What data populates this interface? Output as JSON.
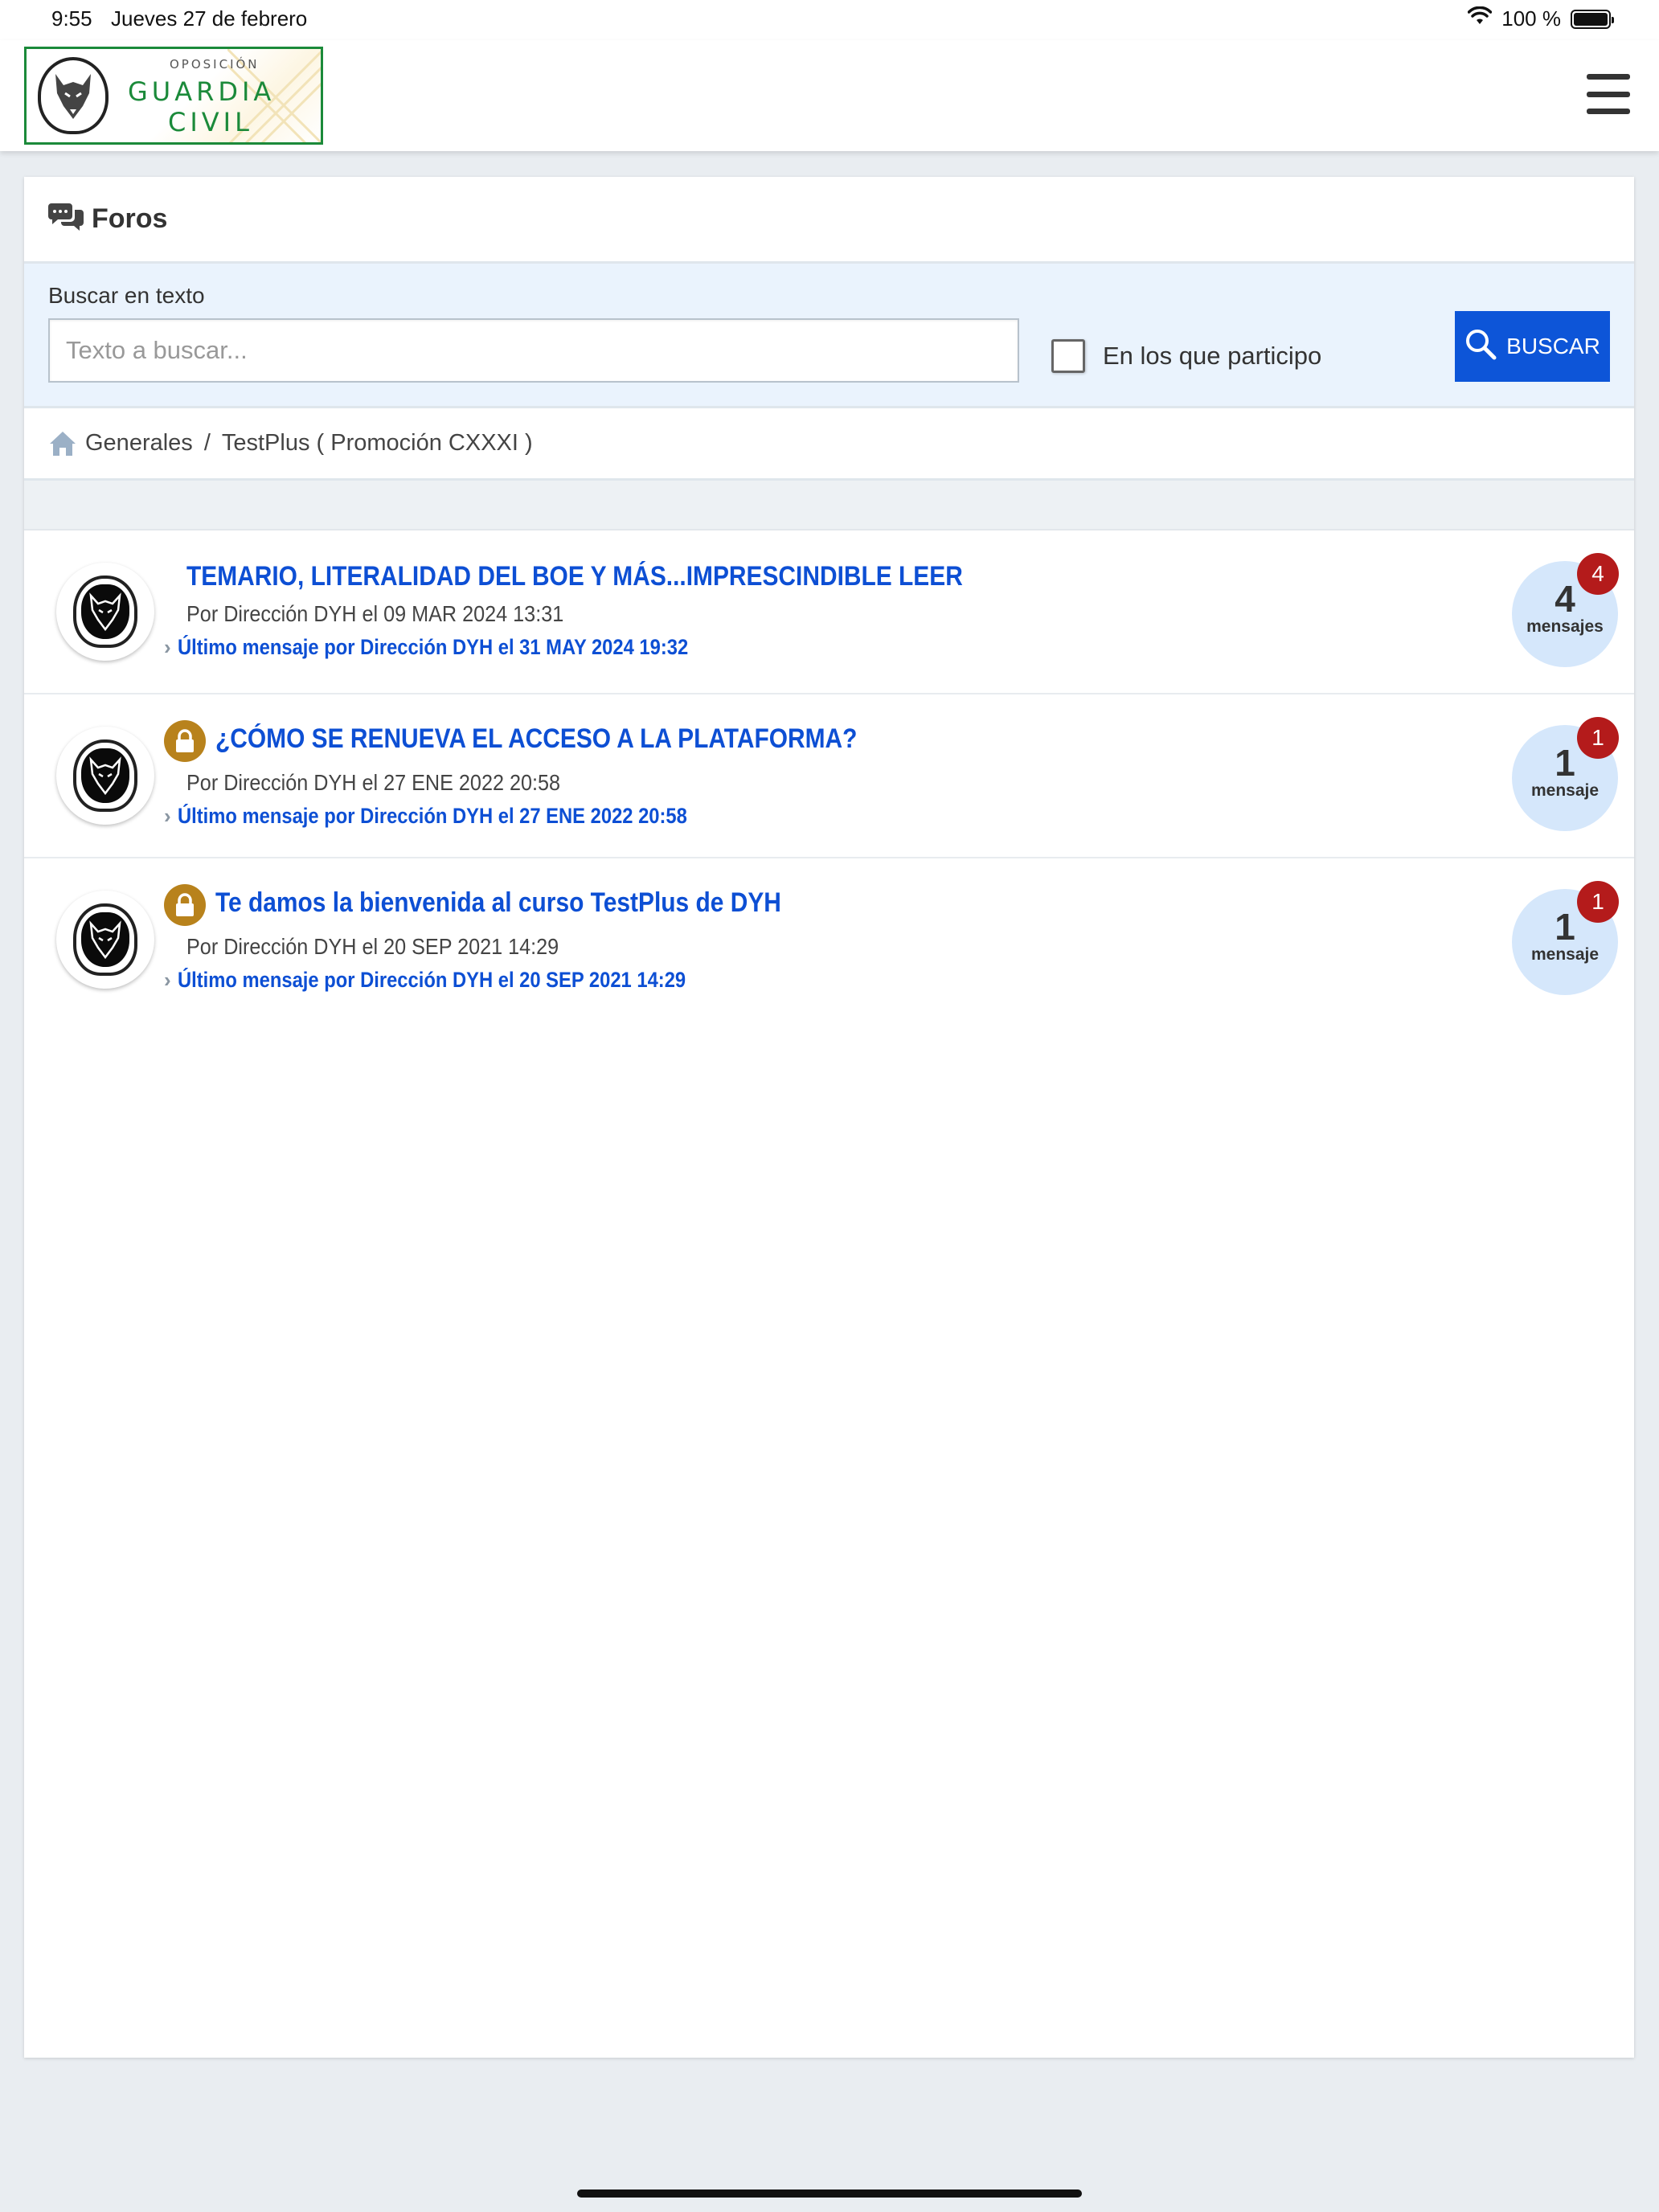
{
  "status_bar": {
    "time": "9:55",
    "date": "Jueves 27 de febrero",
    "battery": "100 %"
  },
  "header": {
    "logo": {
      "subtitle": "OPOSICIÓN",
      "line1": "GUARDIA",
      "line2": "CIVIL"
    },
    "menu_icon": "hamburger-icon"
  },
  "page": {
    "title": "Foros",
    "title_icon": "chat-bubbles-icon"
  },
  "search": {
    "label": "Buscar en texto",
    "placeholder": "Texto a buscar...",
    "value": "",
    "checkbox_label": "En los que participo",
    "checkbox_checked": false,
    "button_label": "BUSCAR"
  },
  "breadcrumb": {
    "items": [
      "Generales",
      "TestPlus ( Promoción CXXXI )"
    ],
    "separator": "/"
  },
  "threads": [
    {
      "title": "TEMARIO, LITERALIDAD DEL BOE Y MÁS...IMPRESCINDIBLE LEER",
      "locked": false,
      "meta": "Por Dirección DYH el 09 MAR 2024 13:31",
      "last_post": "Último mensaje por Dirección DYH el 31 MAY 2024 19:32",
      "count": "4",
      "count_label": "mensajes",
      "badge": "4"
    },
    {
      "title": "¿CÓMO SE RENUEVA EL ACCESO A LA PLATAFORMA?",
      "locked": true,
      "meta": "Por Dirección DYH el 27 ENE 2022 20:58",
      "last_post": "Último mensaje por Dirección DYH el 27 ENE 2022 20:58",
      "count": "1",
      "count_label": "mensaje",
      "badge": "1"
    },
    {
      "title": "Te damos la bienvenida al curso TestPlus de DYH",
      "locked": true,
      "meta": "Por Dirección DYH el 20 SEP 2021 14:29",
      "last_post": "Último mensaje por Dirección DYH el 20 SEP 2021 14:29",
      "count": "1",
      "count_label": "mensaje",
      "badge": "1"
    }
  ],
  "colors": {
    "link_blue": "#0d4fd4",
    "button_blue": "#0d55d8",
    "badge_red": "#b41b1b",
    "lock_gold": "#b8821c",
    "logo_green": "#1b8a3a"
  }
}
